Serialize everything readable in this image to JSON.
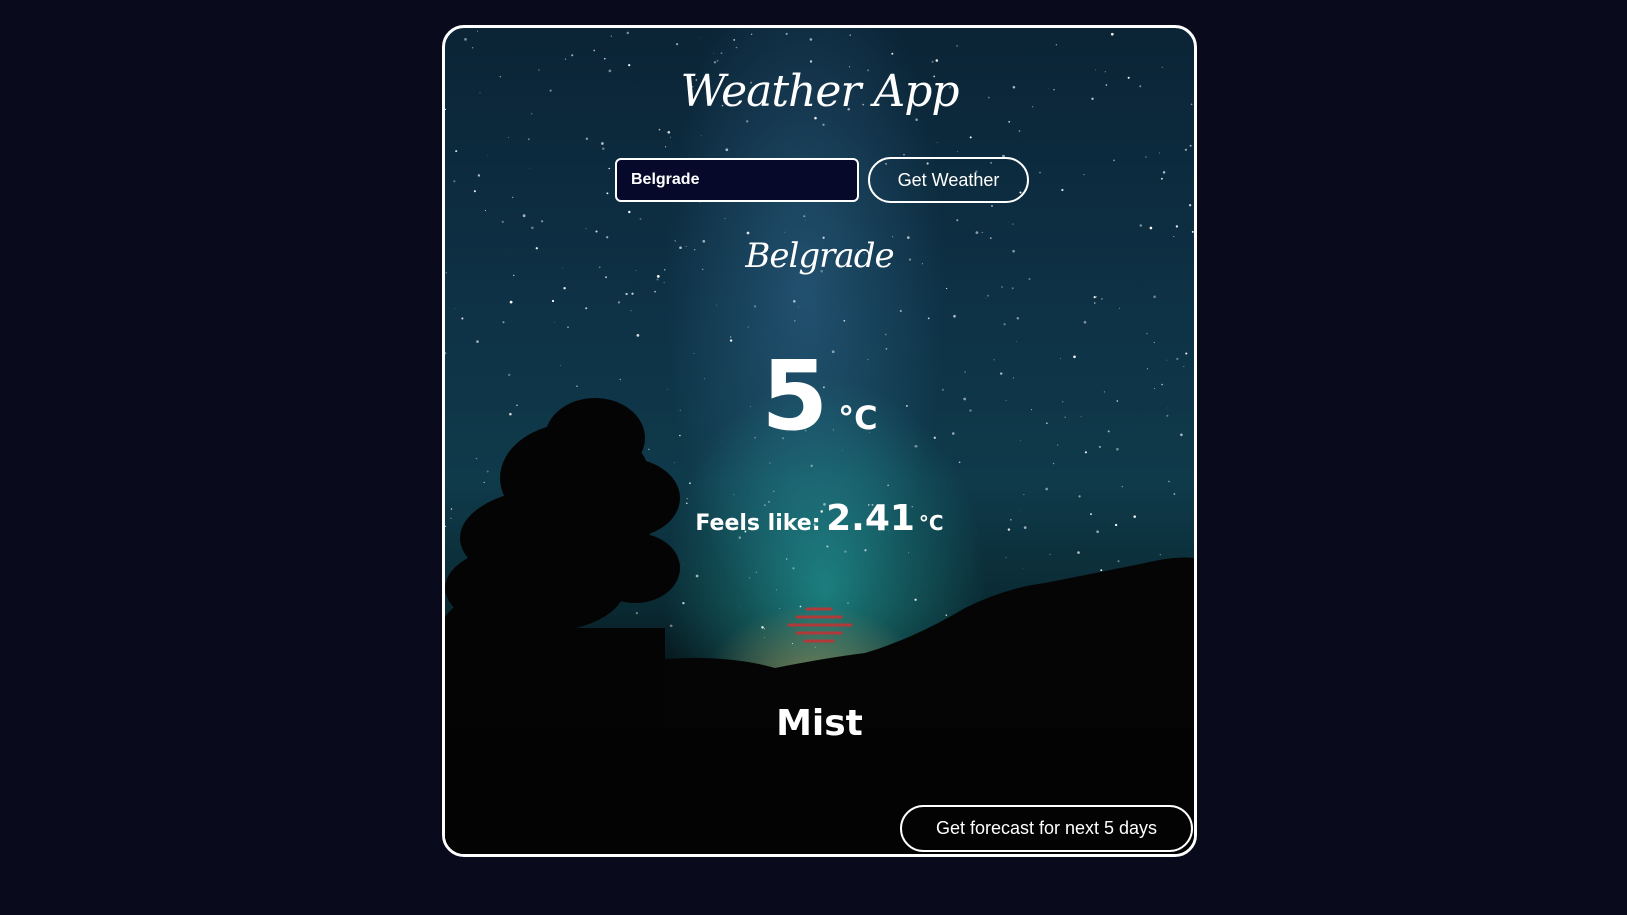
{
  "app": {
    "title": "Weather App"
  },
  "search": {
    "value": "Belgrade",
    "button_label": "Get Weather"
  },
  "weather": {
    "city": "Belgrade",
    "temperature": "5",
    "temperature_unit": "°C",
    "feels_like_label": "Feels like:",
    "feels_like_value": "2.41",
    "feels_like_unit": "°C",
    "icon": "mist-icon",
    "icon_color": "#b03a3a",
    "description": "Mist"
  },
  "forecast": {
    "button_label": "Get forecast for next 5 days"
  }
}
